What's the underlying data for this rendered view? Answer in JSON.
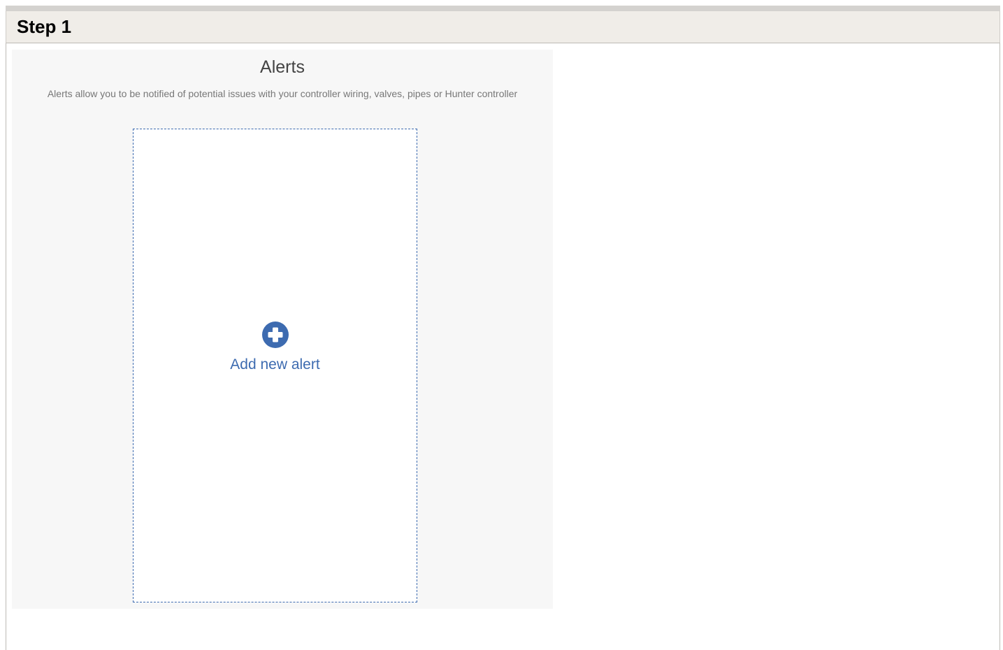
{
  "header": {
    "step_title": "Step 1"
  },
  "alerts": {
    "title": "Alerts",
    "description": "Alerts allow you to be notified of potential issues with your controller wiring, valves, pipes or Hunter controller",
    "add_button": {
      "label": "Add new alert",
      "icon": "plus-circle-icon"
    }
  },
  "colors": {
    "accent": "#3d6bb0",
    "header_bg": "#f0ede8",
    "panel_bg": "#f7f7f7"
  }
}
